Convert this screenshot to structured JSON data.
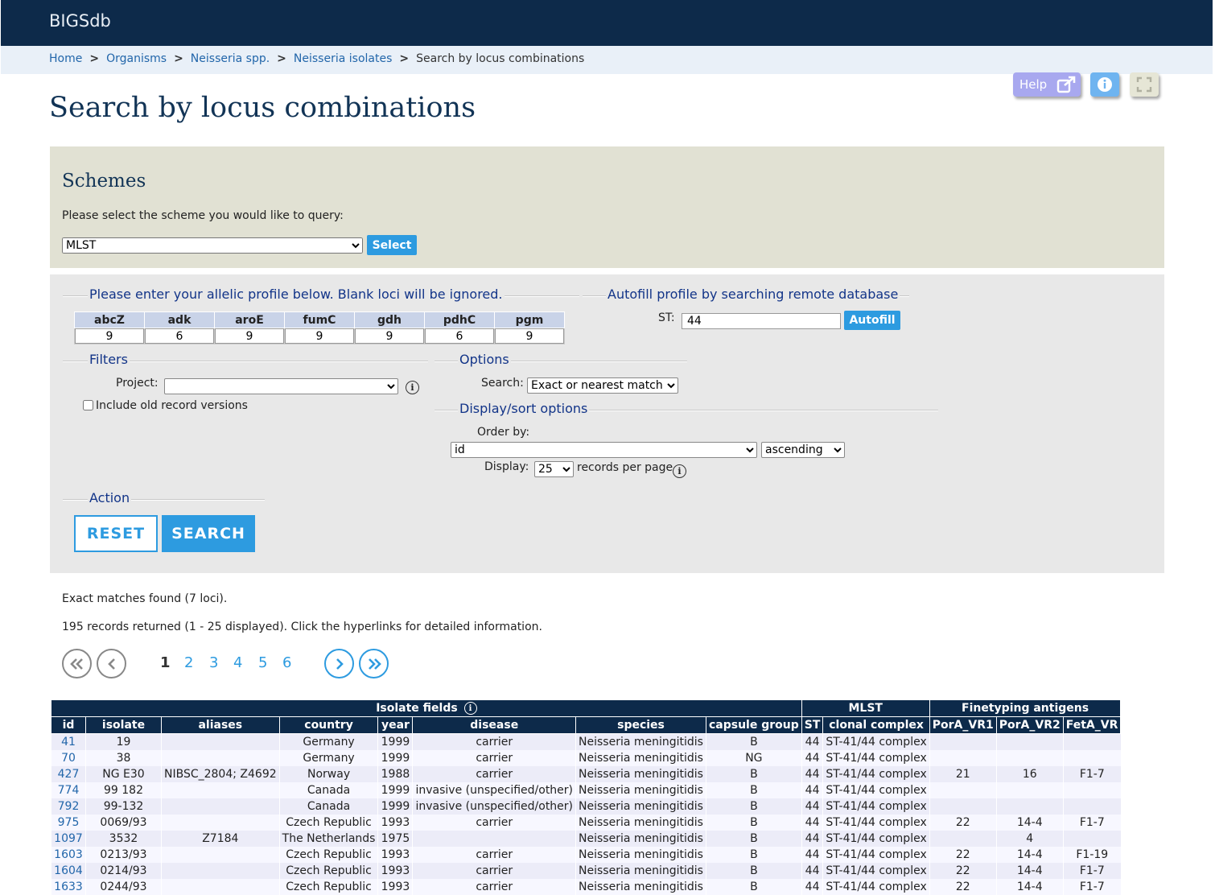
{
  "app": {
    "brand": "BIGSdb"
  },
  "breadcrumb": [
    {
      "label": "Home",
      "link": true
    },
    {
      "label": "Organisms",
      "link": true
    },
    {
      "label": "Neisseria spp.",
      "link": true
    },
    {
      "label": "Neisseria isolates",
      "link": true
    },
    {
      "label": "Search by locus combinations",
      "link": false
    }
  ],
  "toolbar": {
    "help_label": "Help"
  },
  "page": {
    "title": "Search by locus combinations"
  },
  "schemes": {
    "heading": "Schemes",
    "prompt": "Please select the scheme you would like to query:",
    "selected": "MLST",
    "select_button": "Select"
  },
  "profile": {
    "legend": "Please enter your allelic profile below. Blank loci will be ignored.",
    "loci": [
      "abcZ",
      "adk",
      "aroE",
      "fumC",
      "gdh",
      "pdhC",
      "pgm"
    ],
    "values": [
      "9",
      "6",
      "9",
      "9",
      "9",
      "6",
      "9"
    ]
  },
  "autofill": {
    "legend": "Autofill profile by searching remote database",
    "st_label": "ST:",
    "st_value": "44",
    "button": "Autofill"
  },
  "filters": {
    "legend": "Filters",
    "project_label": "Project:",
    "project_value": "",
    "old_versions_label": "Include old record versions"
  },
  "options": {
    "legend": "Options",
    "search_label": "Search:",
    "search_value": "Exact or nearest match"
  },
  "display_sort": {
    "legend": "Display/sort options",
    "order_label": "Order by:",
    "order_value": "id",
    "direction_value": "ascending",
    "display_label": "Display:",
    "per_page_value": "25",
    "per_page_suffix": "records per page"
  },
  "action": {
    "legend": "Action",
    "reset": "RESET",
    "search": "SEARCH"
  },
  "results": {
    "match_message": "Exact matches found (7 loci).",
    "count_message": "195 records returned (1 - 25 displayed). Click the hyperlinks for detailed information.",
    "pages": [
      "1",
      "2",
      "3",
      "4",
      "5",
      "6"
    ],
    "current_page": "1",
    "group_headers": [
      "Isolate fields",
      "MLST",
      "Finetyping antigens"
    ],
    "columns": [
      "id",
      "isolate",
      "aliases",
      "country",
      "year",
      "disease",
      "species",
      "capsule group",
      "ST",
      "clonal complex",
      "PorA_VR1",
      "PorA_VR2",
      "FetA_VR"
    ],
    "rows": [
      [
        "41",
        "19",
        "",
        "Germany",
        "1999",
        "carrier",
        "Neisseria meningitidis",
        "B",
        "44",
        "ST-41/44 complex",
        "",
        "",
        ""
      ],
      [
        "70",
        "38",
        "",
        "Germany",
        "1999",
        "carrier",
        "Neisseria meningitidis",
        "NG",
        "44",
        "ST-41/44 complex",
        "",
        "",
        ""
      ],
      [
        "427",
        "NG E30",
        "NIBSC_2804; Z4692",
        "Norway",
        "1988",
        "carrier",
        "Neisseria meningitidis",
        "B",
        "44",
        "ST-41/44 complex",
        "21",
        "16",
        "F1-7"
      ],
      [
        "774",
        "99 182",
        "",
        "Canada",
        "1999",
        "invasive (unspecified/other)",
        "Neisseria meningitidis",
        "B",
        "44",
        "ST-41/44 complex",
        "",
        "",
        ""
      ],
      [
        "792",
        "99-132",
        "",
        "Canada",
        "1999",
        "invasive (unspecified/other)",
        "Neisseria meningitidis",
        "B",
        "44",
        "ST-41/44 complex",
        "",
        "",
        ""
      ],
      [
        "975",
        "0069/93",
        "",
        "Czech Republic",
        "1993",
        "carrier",
        "Neisseria meningitidis",
        "B",
        "44",
        "ST-41/44 complex",
        "22",
        "14-4",
        "F1-7"
      ],
      [
        "1097",
        "3532",
        "Z7184",
        "The Netherlands",
        "1975",
        "",
        "Neisseria meningitidis",
        "B",
        "44",
        "ST-41/44 complex",
        "",
        "4",
        ""
      ],
      [
        "1603",
        "0213/93",
        "",
        "Czech Republic",
        "1993",
        "carrier",
        "Neisseria meningitidis",
        "B",
        "44",
        "ST-41/44 complex",
        "22",
        "14-4",
        "F1-19"
      ],
      [
        "1604",
        "0214/93",
        "",
        "Czech Republic",
        "1993",
        "carrier",
        "Neisseria meningitidis",
        "B",
        "44",
        "ST-41/44 complex",
        "22",
        "14-4",
        "F1-7"
      ],
      [
        "1633",
        "0244/93",
        "",
        "Czech Republic",
        "1993",
        "carrier",
        "Neisseria meningitidis",
        "B",
        "44",
        "ST-41/44 complex",
        "22",
        "14-4",
        "F1-7"
      ]
    ]
  },
  "colors": {
    "header_bg": "#0d2a4a",
    "crumb_bg": "#e9f0f8",
    "accent": "#2d9be0",
    "link": "#2266aa",
    "legend": "#123488",
    "scheme_panel": "#e1e1d3",
    "form_panel": "#e8e8e8"
  },
  "icons": [
    "external-link-icon",
    "info-icon",
    "fullscreen-icon",
    "double-chevron-left-icon",
    "chevron-left-icon",
    "chevron-right-icon",
    "double-chevron-right-icon"
  ]
}
